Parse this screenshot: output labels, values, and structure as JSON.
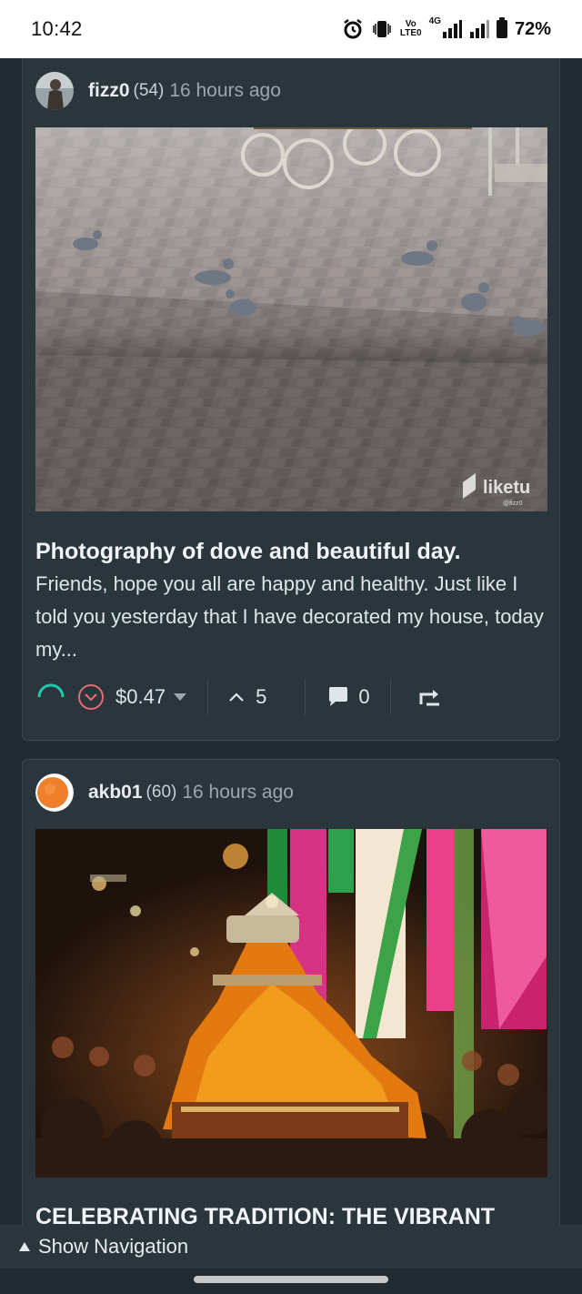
{
  "status_bar": {
    "time": "10:42",
    "network_top": "Vo",
    "network_bottom": "LTE0",
    "data_label": "4G",
    "battery": "72%"
  },
  "posts": [
    {
      "author": "fizz0",
      "reputation": "(54)",
      "time_ago": "16 hours ago",
      "watermark": "liketu",
      "watermark_sub": "@fizz0",
      "title": "Photography of dove and beautiful day.",
      "excerpt": "Friends, hope you all are happy and healthy. Just like I told you yesterday that I have decorated my house, today my...",
      "payout": "$0.47",
      "votes": "5",
      "comments": "0"
    },
    {
      "author": "akb01",
      "reputation": "(60)",
      "time_ago": "16 hours ago",
      "title": "CELEBRATING TRADITION: THE VIBRANT"
    }
  ],
  "nav": {
    "show_label": "Show Navigation"
  }
}
